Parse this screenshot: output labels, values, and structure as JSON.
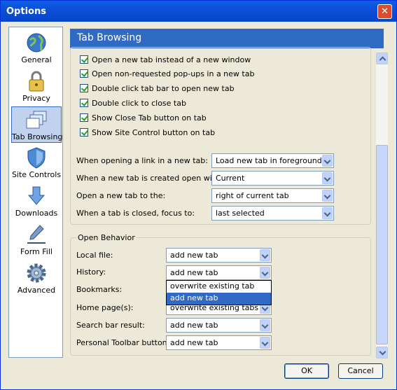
{
  "window": {
    "title": "Options",
    "close_glyph": "✕"
  },
  "sidebar": {
    "items": [
      {
        "label": "General",
        "icon": "globe-icon"
      },
      {
        "label": "Privacy",
        "icon": "lock-icon"
      },
      {
        "label": "Tab Browsing",
        "icon": "tabs-icon",
        "selected": true
      },
      {
        "label": "Site Controls",
        "icon": "shield-icon"
      },
      {
        "label": "Downloads",
        "icon": "download-arrow-icon"
      },
      {
        "label": "Form Fill",
        "icon": "pen-icon"
      },
      {
        "label": "Advanced",
        "icon": "gear-icon"
      }
    ]
  },
  "header": {
    "title": "Tab Browsing"
  },
  "checkboxes": [
    {
      "label": "Open a new tab instead of a new window",
      "checked": true
    },
    {
      "label": "Open non-requested pop-ups in a new tab",
      "checked": true
    },
    {
      "label": "Double click tab bar to open new tab",
      "checked": true
    },
    {
      "label": "Double click to close tab",
      "checked": true
    },
    {
      "label": "Show Close Tab button on tab",
      "checked": true
    },
    {
      "label": "Show Site Control button on tab",
      "checked": true
    }
  ],
  "selects": [
    {
      "label": "When opening a link in a new tab:",
      "value": "Load new tab in foreground"
    },
    {
      "label": "When a new tab is created open with:",
      "value": "Current"
    },
    {
      "label": "Open a new tab to the:",
      "value": "right of current tab"
    },
    {
      "label": "When a tab is closed, focus to:",
      "value": "last selected"
    }
  ],
  "open_behavior": {
    "legend": "Open Behavior",
    "rows": [
      {
        "label": "Local file:",
        "value": "add new tab"
      },
      {
        "label": "History:",
        "value": "add new tab"
      },
      {
        "label": "Bookmarks:",
        "value": ""
      },
      {
        "label": "Home page(s):",
        "value": "overwrite existing tabs"
      },
      {
        "label": "Search bar result:",
        "value": "add new tab"
      },
      {
        "label": "Personal Toolbar button:",
        "value": "add new tab"
      }
    ],
    "dropdown_options": [
      "overwrite existing tab",
      "add new tab"
    ]
  },
  "buttons": {
    "ok": "OK",
    "cancel": "Cancel"
  },
  "colors": {
    "selection": "#316ac5",
    "titlebar": "#0a5fe6",
    "face": "#ece9d8"
  }
}
